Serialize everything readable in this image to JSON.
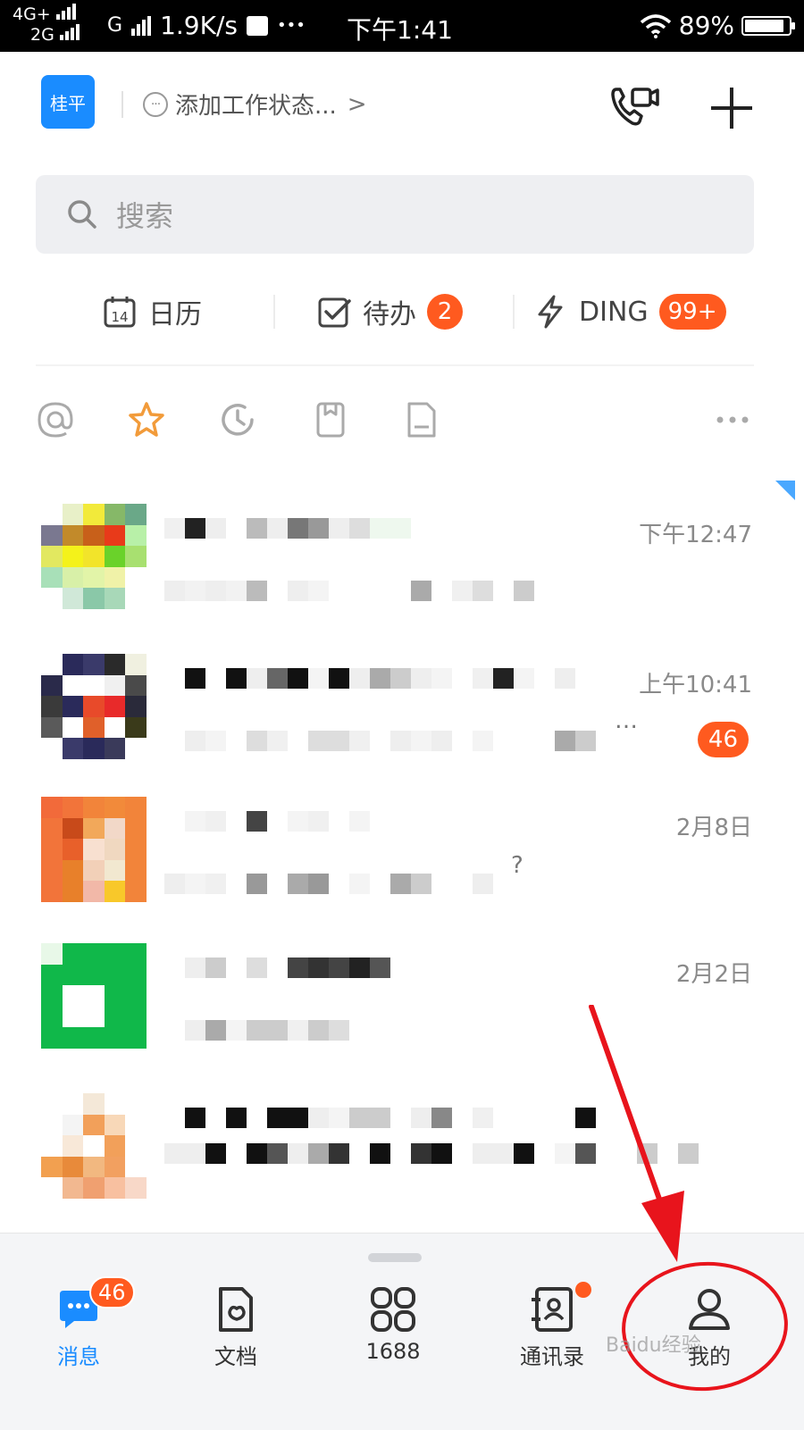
{
  "status_bar": {
    "network_top": "4G+",
    "network_bottom": "2G",
    "network_g": "G",
    "speed": "1.9K/s",
    "dots": "•••",
    "time": "下午1:41",
    "battery": "89%",
    "battery_level": 0.89
  },
  "header": {
    "avatar_text": "桂平",
    "status_text": "添加工作状态...",
    "status_chevron": ">",
    "status_bubble": "···"
  },
  "search": {
    "placeholder": "搜索"
  },
  "shortcuts": {
    "calendar": {
      "label": "日历",
      "icon_day": "14"
    },
    "todo": {
      "label": "待办",
      "badge": "2"
    },
    "ding": {
      "label": "DING",
      "badge": "99+"
    }
  },
  "filters": [
    "at-icon",
    "star-icon",
    "recent-icon",
    "bookmark-icon",
    "document-icon",
    "more-icon"
  ],
  "conversations": [
    {
      "time": "下午12:47"
    },
    {
      "time": "上午10:41",
      "unread": "46",
      "trail": "…"
    },
    {
      "time": "2月8日",
      "trail": "?"
    },
    {
      "time": "2月2日"
    },
    {
      "time": ""
    }
  ],
  "tabbar": {
    "tabs": [
      {
        "label": "消息",
        "badge": "46",
        "icon": "message-icon"
      },
      {
        "label": "文档",
        "icon": "document-icon"
      },
      {
        "label": "1688",
        "icon": "apps-icon"
      },
      {
        "label": "通讯录",
        "icon": "contacts-icon"
      },
      {
        "label": "我的",
        "icon": "profile-icon"
      }
    ]
  },
  "watermark": "Baidu经验",
  "colors": {
    "accent": "#1a8cff",
    "badge": "#ff5a1f",
    "annotation": "#e8141c"
  }
}
